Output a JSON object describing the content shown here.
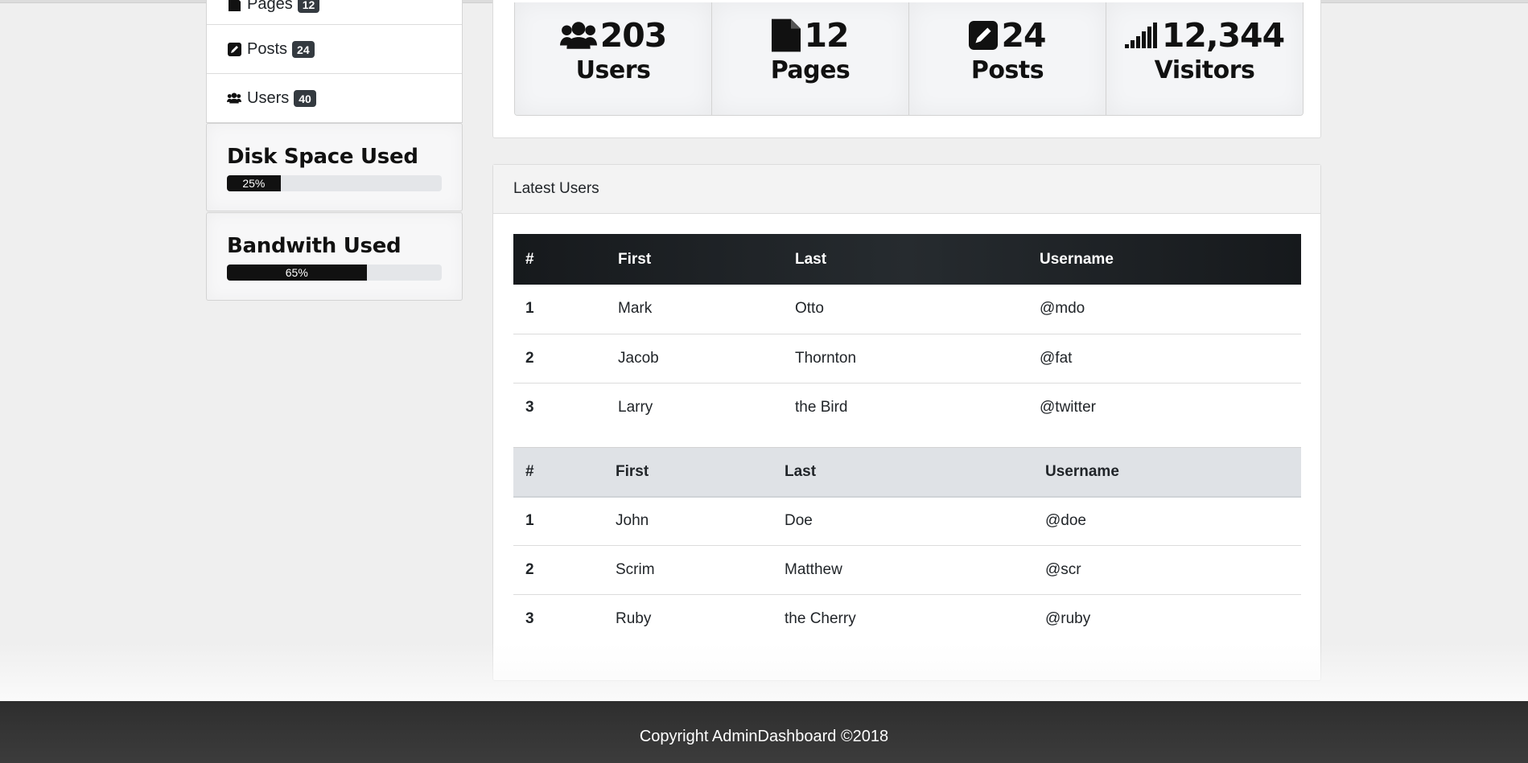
{
  "sidebar": {
    "items": [
      {
        "label": "Pages",
        "badge": "12",
        "icon": "file-icon"
      },
      {
        "label": "Posts",
        "badge": "24",
        "icon": "pencil-icon"
      },
      {
        "label": "Users",
        "badge": "40",
        "icon": "users-icon"
      }
    ],
    "disk": {
      "title": "Disk Space Used",
      "percent_label": "25%",
      "percent": 25
    },
    "bandwidth": {
      "title": "Bandwith Used",
      "percent_label": "65%",
      "percent": 65
    }
  },
  "stats": [
    {
      "value": "203",
      "label": "Users",
      "icon": "users-icon"
    },
    {
      "value": "12",
      "label": "Pages",
      "icon": "file-icon"
    },
    {
      "value": "24",
      "label": "Posts",
      "icon": "pencil-icon"
    },
    {
      "value": "12,344",
      "label": "Visitors",
      "icon": "signal-icon"
    }
  ],
  "latest_users": {
    "title": "Latest Users",
    "headers": [
      "#",
      "First",
      "Last",
      "Username"
    ],
    "rows": [
      [
        "1",
        "Mark",
        "Otto",
        "@mdo"
      ],
      [
        "2",
        "Jacob",
        "Thornton",
        "@fat"
      ],
      [
        "3",
        "Larry",
        "the Bird",
        "@twitter"
      ]
    ],
    "headers2": [
      "#",
      "First",
      "Last",
      "Username"
    ],
    "rows2": [
      [
        "1",
        "John",
        "Doe",
        "@doe"
      ],
      [
        "2",
        "Scrim",
        "Matthew",
        "@scr"
      ],
      [
        "3",
        "Ruby",
        "the Cherry",
        "@ruby"
      ]
    ]
  },
  "footer": {
    "text": "Copyright AdminDashboard ©2018"
  }
}
